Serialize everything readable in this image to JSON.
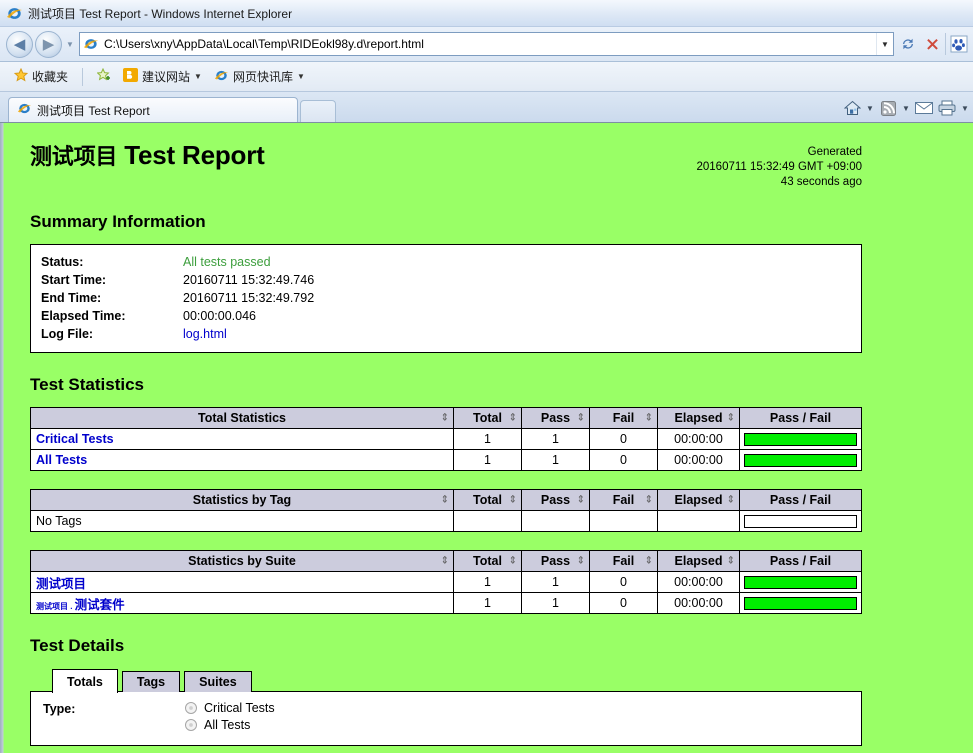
{
  "browser": {
    "title": "测试项目 Test Report - Windows Internet Explorer",
    "back_icon": "back-arrow-icon",
    "forward_icon": "forward-arrow-icon",
    "url": "C:\\Users\\xny\\AppData\\Local\\Temp\\RIDEokl98y.d\\report.html",
    "refresh_icon": "refresh-icon",
    "stop_icon": "stop-icon",
    "favorites": {
      "label": "收藏夹",
      "items": [
        {
          "label": "建议网站",
          "icon": "suggested-sites-icon"
        },
        {
          "label": "网页快讯库",
          "icon": "web-slice-icon"
        }
      ]
    },
    "tab": {
      "label": "测试项目 Test Report"
    },
    "commands": [
      "home-icon",
      "feeds-icon",
      "mail-icon",
      "print-icon"
    ]
  },
  "report": {
    "title_cn": "测试项目",
    "title_en": "Test Report",
    "generated": {
      "label": "Generated",
      "timestamp": "20160711 15:32:49 GMT +09:00",
      "relative": "43 seconds ago"
    },
    "summary": {
      "heading": "Summary Information",
      "rows": [
        {
          "label": "Status:",
          "value": "All tests passed",
          "style": "pass"
        },
        {
          "label": "Start Time:",
          "value": "20160711 15:32:49.746",
          "style": "plain"
        },
        {
          "label": "End Time:",
          "value": "20160711 15:32:49.792",
          "style": "plain"
        },
        {
          "label": "Elapsed Time:",
          "value": "00:00:00.046",
          "style": "plain"
        },
        {
          "label": "Log File:",
          "value": "log.html",
          "style": "link"
        }
      ]
    },
    "statistics": {
      "heading": "Test Statistics",
      "columns": {
        "total": "Total",
        "pass": "Pass",
        "fail": "Fail",
        "elapsed": "Elapsed",
        "graph": "Pass / Fail"
      },
      "sort_glyph": "⇕",
      "tables": [
        {
          "name": "Total Statistics",
          "rows": [
            {
              "label": "Critical Tests",
              "total": "1",
              "pass": "1",
              "fail": "0",
              "elapsed": "00:00:00",
              "pass_pct": 100,
              "fail_pct": 0,
              "link": true
            },
            {
              "label": "All Tests",
              "total": "1",
              "pass": "1",
              "fail": "0",
              "elapsed": "00:00:00",
              "pass_pct": 100,
              "fail_pct": 0,
              "link": true
            }
          ]
        },
        {
          "name": "Statistics by Tag",
          "rows": [
            {
              "label": "No Tags",
              "total": "",
              "pass": "",
              "fail": "",
              "elapsed": "",
              "pass_pct": 0,
              "fail_pct": 0,
              "link": false,
              "empty": true
            }
          ]
        },
        {
          "name": "Statistics by Suite",
          "rows": [
            {
              "label": "测试项目",
              "total": "1",
              "pass": "1",
              "fail": "0",
              "elapsed": "00:00:00",
              "pass_pct": 100,
              "fail_pct": 0,
              "link": true
            },
            {
              "prefix": "测试项目 . ",
              "label": "测试套件",
              "total": "1",
              "pass": "1",
              "fail": "0",
              "elapsed": "00:00:00",
              "pass_pct": 100,
              "fail_pct": 0,
              "link": true
            }
          ]
        }
      ]
    },
    "details": {
      "heading": "Test Details",
      "tabs": [
        {
          "label": "Totals",
          "active": true
        },
        {
          "label": "Tags",
          "active": false
        },
        {
          "label": "Suites",
          "active": false
        }
      ],
      "type_label": "Type:",
      "type_options": [
        {
          "label": "Critical Tests",
          "selected": false
        },
        {
          "label": "All Tests",
          "selected": false
        }
      ]
    },
    "colors": {
      "page_background": "#99ff66",
      "table_header": "#ccccdd",
      "pass_bar": "#00ee00",
      "fail_bar": "#ff3333",
      "link": "#0000cc",
      "pass_text": "#3c9e3c"
    }
  }
}
